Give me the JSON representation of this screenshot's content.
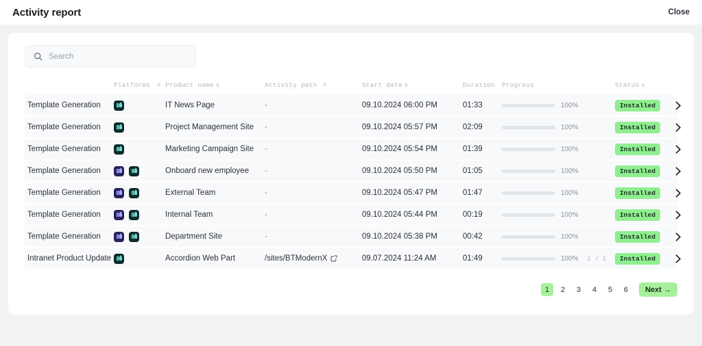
{
  "header": {
    "title": "Activity report",
    "close_label": "Close"
  },
  "search": {
    "placeholder": "Search",
    "value": "",
    "icon": "search-icon"
  },
  "table": {
    "columns": [
      {
        "label": "",
        "sortable": false
      },
      {
        "label": "Platforms",
        "sortable": true
      },
      {
        "label": "Product name",
        "sortable": true
      },
      {
        "label": "Activity path",
        "sortable": true
      },
      {
        "label": "Start date",
        "sortable": true
      },
      {
        "label": "Duration",
        "sortable": false
      },
      {
        "label": "Progress",
        "sortable": false
      },
      {
        "label": "Status",
        "sortable": true
      }
    ],
    "sort_glyph": "⇅",
    "rows": [
      {
        "activity": "Template Generation",
        "platforms": [
          "sharepoint"
        ],
        "product": "IT News Page",
        "path": "-",
        "path_link": false,
        "start": "09.10.2024 06:00 PM",
        "duration": "01:33",
        "progress": 100,
        "progress_label": "100%",
        "count": "",
        "status": "Installed"
      },
      {
        "activity": "Template Generation",
        "platforms": [
          "sharepoint"
        ],
        "product": "Project Management Site",
        "path": "-",
        "path_link": false,
        "start": "09.10.2024 05:57 PM",
        "duration": "02:09",
        "progress": 100,
        "progress_label": "100%",
        "count": "",
        "status": "Installed"
      },
      {
        "activity": "Template Generation",
        "platforms": [
          "sharepoint"
        ],
        "product": "Marketing Campaign Site",
        "path": "-",
        "path_link": false,
        "start": "09.10.2024 05:54 PM",
        "duration": "01:39",
        "progress": 100,
        "progress_label": "100%",
        "count": "",
        "status": "Installed"
      },
      {
        "activity": "Template Generation",
        "platforms": [
          "teams",
          "sharepoint"
        ],
        "product": "Onboard new employee",
        "path": "-",
        "path_link": false,
        "start": "09.10.2024 05:50 PM",
        "duration": "01:05",
        "progress": 100,
        "progress_label": "100%",
        "count": "",
        "status": "Installed"
      },
      {
        "activity": "Template Generation",
        "platforms": [
          "teams",
          "sharepoint"
        ],
        "product": "External Team",
        "path": "-",
        "path_link": false,
        "start": "09.10.2024 05:47 PM",
        "duration": "01:47",
        "progress": 100,
        "progress_label": "100%",
        "count": "",
        "status": "Installed"
      },
      {
        "activity": "Template Generation",
        "platforms": [
          "teams",
          "sharepoint"
        ],
        "product": "Internal Team",
        "path": "-",
        "path_link": false,
        "start": "09.10.2024 05:44 PM",
        "duration": "00:19",
        "progress": 100,
        "progress_label": "100%",
        "count": "",
        "status": "Installed"
      },
      {
        "activity": "Template Generation",
        "platforms": [
          "teams",
          "sharepoint"
        ],
        "product": "Department Site",
        "path": "-",
        "path_link": false,
        "start": "09.10.2024 05:38 PM",
        "duration": "00:42",
        "progress": 100,
        "progress_label": "100%",
        "count": "",
        "status": "Installed"
      },
      {
        "activity": "Intranet Product Update",
        "platforms": [
          "sharepoint"
        ],
        "product": "Accordion Web Part",
        "path": "/sites/BTModernX",
        "path_link": true,
        "start": "09.07.2024 11:24 AM",
        "duration": "01:49",
        "progress": 100,
        "progress_label": "100%",
        "count": "1 / 1",
        "status": "Installed"
      }
    ]
  },
  "pagination": {
    "pages": [
      "1",
      "2",
      "3",
      "4",
      "5",
      "6"
    ],
    "active": "1",
    "next_label": "Next →"
  },
  "colors": {
    "page_bg": "#f1f2f4",
    "card_bg": "#ffffff",
    "row_bg": "#f8f9fa",
    "progress_fill": "#8fdc7f",
    "badge_bg": "#90ee90",
    "accent_green": "#a8ef9d",
    "teams_icon": "#2b2159",
    "sharepoint_icon": "#0d2b2b"
  }
}
